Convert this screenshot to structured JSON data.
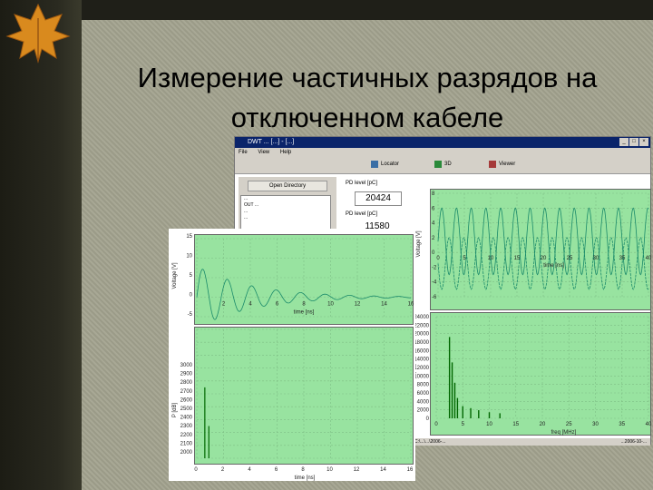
{
  "slide": {
    "title_line1": "Измерение частичных разрядов на",
    "title_line2": "отключенном кабеле"
  },
  "app": {
    "window_title": "DWT ... [...] - [...]",
    "menu": [
      "File",
      "View",
      "Help"
    ],
    "toolbar": [
      "Locator",
      "3D",
      "Viewer"
    ],
    "panel_tab": "Open Directory",
    "tree_items": [
      "...",
      "OUT ...",
      "...",
      "..."
    ],
    "field1_label": "PD level [pC]",
    "field1_value": "20424",
    "field2_label": "PD level [pC]",
    "field2_value": "11580",
    "status_left": "C:\\...\\...\\2006-...",
    "status_right": "...2006-10-..."
  },
  "colors": {
    "chart_bg": "#98e3a0",
    "trace": "#1a8a6a",
    "spectrum": "#006600",
    "title_bar": "#0a246a"
  },
  "chart_data": [
    {
      "type": "line",
      "name": "signal-left",
      "xlabel": "time [ns]",
      "ylabel": "Voltage [V]",
      "xlim": [
        0,
        14
      ],
      "ylim": [
        -5,
        15
      ],
      "xticks": [
        "0",
        "2",
        "4",
        "6",
        "8",
        "10",
        "12",
        "14",
        "16"
      ],
      "yticks": [
        "15",
        "10",
        "5",
        "0",
        "-5"
      ],
      "damped": {
        "amplitude": 8,
        "decay": 0.28,
        "period": 1.6
      }
    },
    {
      "type": "bar",
      "name": "spectrum-left",
      "xlabel": "time [ns]",
      "ylabel": "P [dB]",
      "xticks": [
        "0",
        "2",
        "4",
        "6",
        "8",
        "10",
        "12",
        "14",
        "16"
      ],
      "yticks": [
        "3000",
        "2900",
        "2800",
        "2700",
        "2600",
        "2500",
        "2400",
        "2300",
        "2200",
        "2100",
        "2000"
      ],
      "spikes": [
        {
          "x": 0.6,
          "v": 0.55
        },
        {
          "x": 0.9,
          "v": 0.25
        }
      ]
    },
    {
      "type": "line",
      "name": "signal-right",
      "xlabel": "time [ns]",
      "ylabel": "Voltage [V]",
      "xticks": [
        "0",
        "5",
        "10",
        "15",
        "20",
        "25",
        "30",
        "35",
        "40"
      ],
      "yticks": [
        "8",
        "6",
        "4",
        "2",
        "0",
        "-2",
        "-4",
        "-6"
      ],
      "xlim": [
        0,
        40
      ],
      "ylim": [
        -6,
        8
      ]
    },
    {
      "type": "bar",
      "name": "spectrum-right",
      "xlabel": "freq [MHz]",
      "ylabel": "P [dB]",
      "xticks": [
        "0",
        "5",
        "10",
        "15",
        "20",
        "25",
        "30",
        "35",
        "40"
      ],
      "yticks": [
        "24000",
        "22000",
        "20000",
        "18000",
        "16000",
        "14000",
        "12000",
        "10000",
        "8000",
        "6000",
        "4000",
        "2000",
        "0"
      ],
      "spikes": [
        {
          "x": 2.5,
          "v": 0.8
        },
        {
          "x": 3,
          "v": 0.55
        },
        {
          "x": 3.5,
          "v": 0.35
        },
        {
          "x": 4,
          "v": 0.2
        },
        {
          "x": 5,
          "v": 0.12
        },
        {
          "x": 6.5,
          "v": 0.1
        },
        {
          "x": 8,
          "v": 0.08
        },
        {
          "x": 10,
          "v": 0.06
        },
        {
          "x": 12,
          "v": 0.05
        }
      ]
    }
  ]
}
